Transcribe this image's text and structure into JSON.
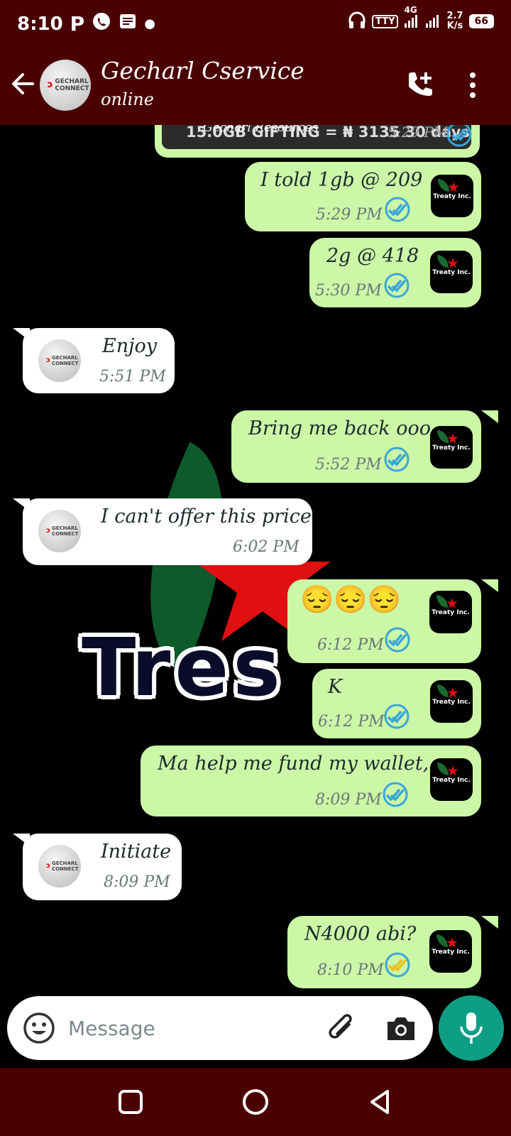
{
  "status_bar": {
    "time": "8:10",
    "network": "4G",
    "tty": "TTY",
    "speed_value": "2.7",
    "speed_unit": "K/s",
    "battery": "66"
  },
  "header": {
    "contact_name": "Gecharl Cservice",
    "status": "online",
    "avatar_text": "GECHARL CONNECT"
  },
  "quoted_message": {
    "sender": "Gecharl Resources",
    "text": "15.0GB GIFTING = ₦ 3135 30 days",
    "time": "5:29 PM"
  },
  "my_avatar_text": "Treaty Inc.",
  "messages": [
    {
      "dir": "out",
      "text": "I told 1gb @ 209",
      "time": "5:29 PM",
      "ticks": "read"
    },
    {
      "dir": "out",
      "text": "2g @ 418",
      "time": "5:30 PM",
      "ticks": "read"
    },
    {
      "dir": "in",
      "text": "Enjoy",
      "time": "5:51 PM"
    },
    {
      "dir": "out",
      "text": "Bring me back ooo",
      "time": "5:52 PM",
      "ticks": "read"
    },
    {
      "dir": "in",
      "text": "I can't offer this price",
      "time": "6:02 PM"
    },
    {
      "dir": "out",
      "text": "😔😔😔",
      "time": "6:12 PM",
      "ticks": "read"
    },
    {
      "dir": "out",
      "text": "K",
      "time": "6:12 PM",
      "ticks": "read"
    },
    {
      "dir": "out",
      "text": "Ma help me fund my wallet,",
      "time": "8:09 PM",
      "ticks": "read"
    },
    {
      "dir": "in",
      "text": "Initiate",
      "time": "8:09 PM"
    },
    {
      "dir": "out",
      "text": "N4000 abi?",
      "time": "8:10 PM",
      "ticks": "delivered"
    }
  ],
  "wallpaper_text": "Tres",
  "composer": {
    "placeholder": "Message"
  },
  "colors": {
    "bar": "#4a0000",
    "outgoing_bubble": "#cbf7a7",
    "incoming_bubble": "#ffffff",
    "read_tick": "#3aa6d9",
    "delivered_tick": "#e8c21a",
    "mic_button": "#0e9e84"
  },
  "icons": [
    "back-arrow-icon",
    "add-call-icon",
    "more-vert-icon",
    "emoji-icon",
    "attach-icon",
    "camera-icon",
    "mic-icon",
    "recents-icon",
    "home-icon",
    "back-icon"
  ]
}
